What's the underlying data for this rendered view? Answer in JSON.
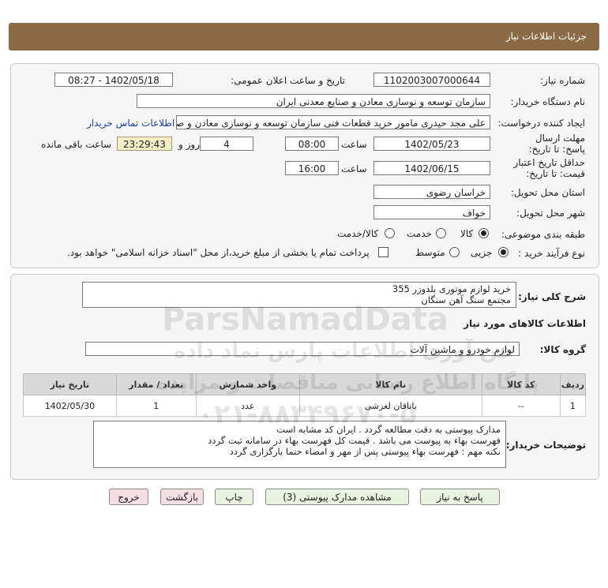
{
  "header": {
    "title": "جزئیات اطلاعات نیاز"
  },
  "form": {
    "need_number_label": "شماره نیاز:",
    "need_number": "1102003007000644",
    "announce_label": "تاریخ و ساعت اعلان عمومی:",
    "announce_value": "1402/05/18 - 08:27",
    "buyer_org_label": "نام دستگاه خریدار:",
    "buyer_org": "سازمان توسعه و نوسازی معادن و صنایع معدنی ایران",
    "creator_label": "ایجاد کننده درخواست:",
    "creator": "علی مجد حیدری مامور خرید قطعات فنی سازمان توسعه و نوسازی معادن و صنا",
    "contact_link": "اطلاعات تماس خریدار",
    "deadline_label": "مهلت ارسال پاسخ: تا تاریخ:",
    "deadline_date": "1402/05/23",
    "time_label": "ساعت",
    "deadline_time": "08:00",
    "days_value": "4",
    "days_label": "روز و",
    "remaining_time": "23:29:43",
    "remaining_label": "ساعت باقی مانده",
    "validity_label": "حداقل تاریخ اعتبار قیمت: تا تاریخ:",
    "validity_date": "1402/06/15",
    "validity_time": "16:00",
    "province_label": "استان محل تحویل:",
    "province": "خراسان رضوی",
    "city_label": "شهر محل تحویل:",
    "city": "خواف",
    "category_label": "طبقه بندی موضوعی:",
    "category_options": [
      "کالا",
      "خدمت",
      "کالا/خدمت"
    ],
    "process_label": "نوع فرآیند خرید :",
    "process_options": [
      "جزیی",
      "متوسط"
    ],
    "payment_note": "پرداخت تمام یا بخشی از مبلغ خرید،از محل \"اسناد خزانه اسلامی\" خواهد بود."
  },
  "summary": {
    "label": "شرح کلی نیاز:",
    "line1": "خرید لوازم موتوری بلدوزر 355",
    "line2": "مجتمع سنگ آهن سنگان"
  },
  "goods": {
    "section_title": "اطلاعات کالاهای مورد نیاز",
    "group_label": "گروه کالا:",
    "group_value": "لوازم خودرو و ماشین آلات",
    "columns": [
      "ردیف",
      "کد کالا",
      "نام کالا",
      "واحد شمارش",
      "تعداد / مقدار",
      "تاریخ نیاز"
    ],
    "rows": [
      [
        "1",
        "--",
        "یاتاقان لغزشی",
        "عدد",
        "1",
        "1402/05/30"
      ]
    ]
  },
  "buyer_notes": {
    "label": "توضیحات خریدار:",
    "line1": "مدارک پیوستی به دقت مطالعه گردد . ایران کد مشابه است",
    "line2": "فهرست بهاء به پیوست می باشد . قیمت کل فهرست بهاء در سامانه ثبت گردد",
    "line3": "نکته مهم : فهرست بهاء پیوستی پس از مهر و امضاء حتما بارگزاری گردد"
  },
  "buttons": {
    "reply": "پاسخ به نیاز",
    "attachments": "مشاهده مدارک پیوستی (3)",
    "print": "چاپ",
    "back": "بازگشت",
    "exit": "خروج"
  },
  "watermark": {
    "brand": "ParsNamadData",
    "phone": "۰۲۱-۸۸۳۴۹۶۷۰-۵",
    "line_a": "پایگاه اطلاع رسانی مناقصات و مزایده",
    "line_b": "فن آوری اطلاعات پارس نماد داده"
  }
}
